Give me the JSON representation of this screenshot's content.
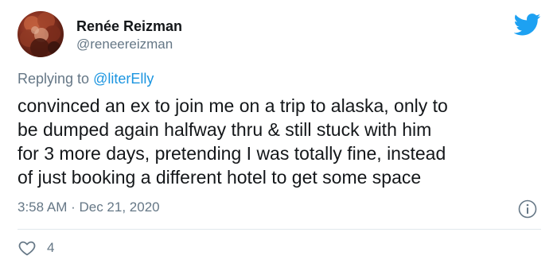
{
  "author": {
    "display_name": "Renée Reizman",
    "handle": "@reneereizman"
  },
  "reply": {
    "prefix": "Replying to ",
    "to": "@literElly"
  },
  "tweet": {
    "lines": [
      "convinced an ex to join me on a trip to alaska, only to",
      "be dumped again halfway thru & still stuck with him",
      "for 3 more days, pretending I was totally fine, instead",
      "of just booking a different hotel to get some space"
    ],
    "timestamp": "3:58 AM · Dec 21, 2020"
  },
  "engagement": {
    "likes": "4"
  },
  "icons": {
    "brand": "twitter-bird-icon",
    "info": "info-icon",
    "like": "heart-icon"
  },
  "colors": {
    "brand_blue": "#1da1f2",
    "link_blue": "#1b95e0",
    "secondary_text": "#657786",
    "primary_text": "#14171a",
    "divider": "#e1e8ed"
  }
}
